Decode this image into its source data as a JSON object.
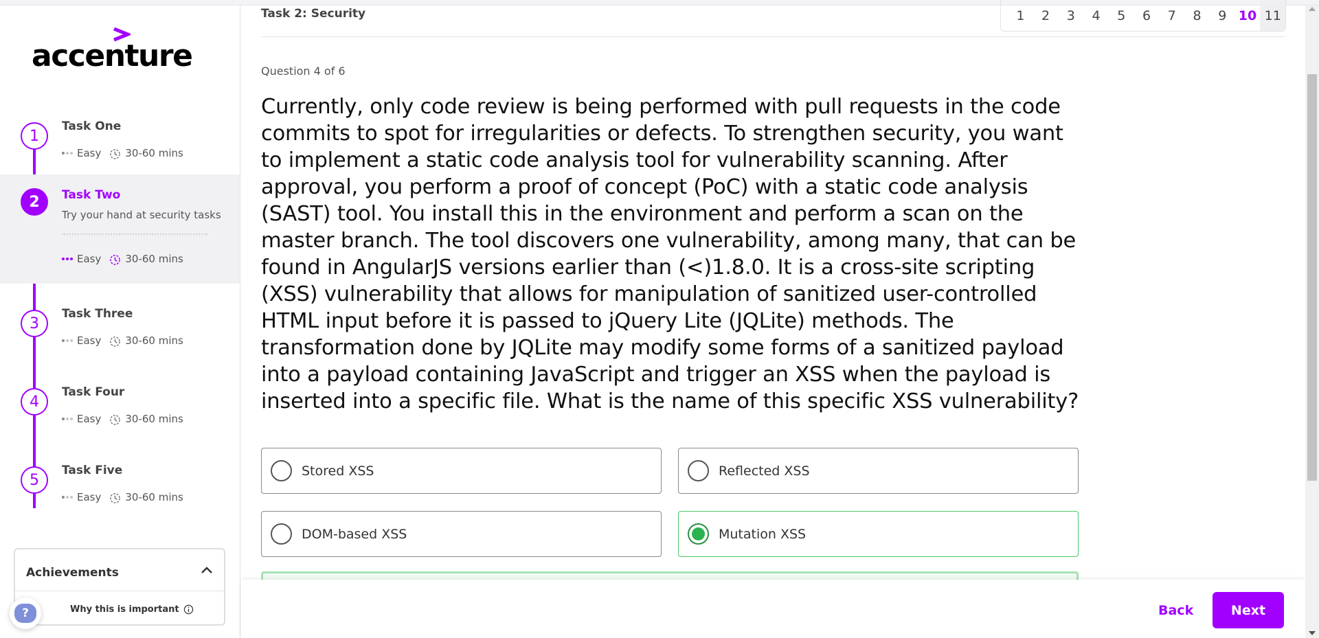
{
  "brand": {
    "logo_text": "accenture"
  },
  "tasks": [
    {
      "number": "1",
      "title": "Task One",
      "difficulty": "Easy",
      "duration": "30-60 mins"
    },
    {
      "number": "2",
      "title": "Task Two",
      "description": "Try your hand at security tasks",
      "difficulty": "Easy",
      "duration": "30-60 mins"
    },
    {
      "number": "3",
      "title": "Task Three",
      "difficulty": "Easy",
      "duration": "30-60 mins"
    },
    {
      "number": "4",
      "title": "Task Four",
      "difficulty": "Easy",
      "duration": "30-60 mins"
    },
    {
      "number": "5",
      "title": "Task Five",
      "difficulty": "Easy",
      "duration": "30-60 mins"
    }
  ],
  "active_task_index": 1,
  "achievements": {
    "title": "Achievements",
    "why_label": "Why this is important"
  },
  "help": {
    "label": "?"
  },
  "header": {
    "task_label": "Task 2: Security"
  },
  "pager": {
    "pages": [
      "1",
      "2",
      "3",
      "4",
      "5",
      "6",
      "7",
      "8",
      "9",
      "10",
      "11"
    ],
    "current": "10"
  },
  "question": {
    "counter": "Question 4 of 6",
    "text": "Currently, only code review is being performed with pull requests in the code commits to spot for irregularities or defects. To strengthen security, you want to implement a static code analysis tool for vulnerability scanning. After approval, you perform a proof of concept (PoC) with a static code analysis (SAST) tool. You install this in the environment and perform a scan on the master branch. The tool discovers one vulnerability, among many, that can be found in AngularJS versions earlier than (<)1.8.0. It is a cross-site scripting (XSS) vulnerability that allows for manipulation of sanitized user-controlled HTML input before it is passed to jQuery Lite (JQLite) methods. The transformation done by JQLite may modify some forms of a sanitized payload into a payload containing JavaScript and trigger an XSS when the payload is inserted into a specific file. What is the name of this specific XSS vulnerability?",
    "options": [
      {
        "label": "Stored XSS",
        "selected": false
      },
      {
        "label": "Reflected XSS",
        "selected": false
      },
      {
        "label": "DOM-based XSS",
        "selected": false
      },
      {
        "label": "Mutation XSS",
        "selected": true
      }
    ]
  },
  "footer": {
    "back_label": "Back",
    "next_label": "Next"
  },
  "colors": {
    "accent": "#a100ff",
    "success": "#2cb251"
  }
}
